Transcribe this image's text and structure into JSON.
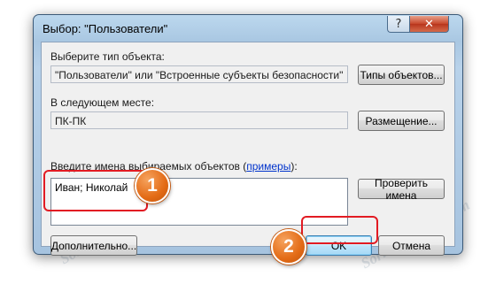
{
  "dialog": {
    "title": "Выбор: \"Пользователи\"",
    "help_glyph": "?",
    "close_glyph": "✕"
  },
  "object_type": {
    "label": "Выберите тип объекта:",
    "value": "\"Пользователи\" или \"Встроенные субъекты безопасности\"",
    "button": "Типы объектов..."
  },
  "location": {
    "label": "В следующем месте:",
    "value": "ПК-ПК",
    "button": "Размещение..."
  },
  "names": {
    "label_prefix": "Введите имена выбираемых объектов (",
    "label_link": "примеры",
    "label_suffix": "):",
    "value": "Иван; Николай",
    "check_button": "Проверить имена"
  },
  "footer": {
    "advanced_button": "Дополнительно...",
    "ok_button": "OK",
    "cancel_button": "Отмена"
  },
  "annotations": {
    "step1": "1",
    "step2": "2"
  },
  "watermark_text": "Soringpcrepair.com"
}
